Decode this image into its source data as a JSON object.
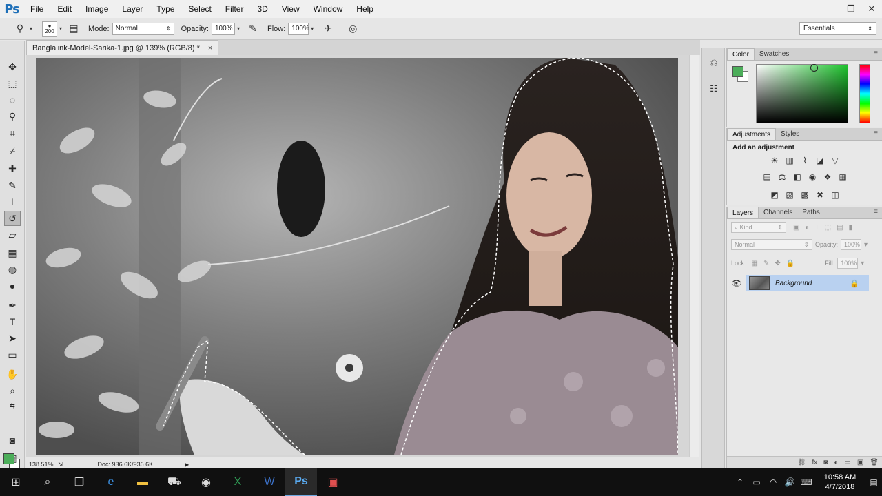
{
  "app": {
    "logo": "Ps"
  },
  "menu": [
    "File",
    "Edit",
    "Image",
    "Layer",
    "Type",
    "Select",
    "Filter",
    "3D",
    "View",
    "Window",
    "Help"
  ],
  "window_controls": {
    "minimize": "—",
    "restore": "❐",
    "close": "✕"
  },
  "options_bar": {
    "brush_size": "200",
    "mode_label": "Mode:",
    "mode_value": "Normal",
    "opacity_label": "Opacity:",
    "opacity_value": "100%",
    "flow_label": "Flow:",
    "flow_value": "100%",
    "workspace": "Essentials"
  },
  "document": {
    "tab_title": "Banglalink-Model-Sarika-1.jpg @ 139% (RGB/8) *",
    "close": "×"
  },
  "status": {
    "zoom": "138.51%",
    "doc_size": "Doc: 936.6K/936.6K"
  },
  "color_panel": {
    "tabs": [
      "Color",
      "Swatches"
    ],
    "foreground": "#4cae5a",
    "background": "#ffffff"
  },
  "adjustments_panel": {
    "tabs": [
      "Adjustments",
      "Styles"
    ],
    "title": "Add an adjustment"
  },
  "layers_panel": {
    "tabs": [
      "Layers",
      "Channels",
      "Paths"
    ],
    "filter_kind": "Kind",
    "blend_mode": "Normal",
    "opacity_label": "Opacity:",
    "opacity_value": "100%",
    "lock_label": "Lock:",
    "fill_label": "Fill:",
    "fill_value": "100%",
    "layers": [
      {
        "name": "Background",
        "visible": true,
        "locked": true
      }
    ]
  },
  "taskbar": {
    "time": "10:58 AM",
    "date": "4/7/2018"
  }
}
